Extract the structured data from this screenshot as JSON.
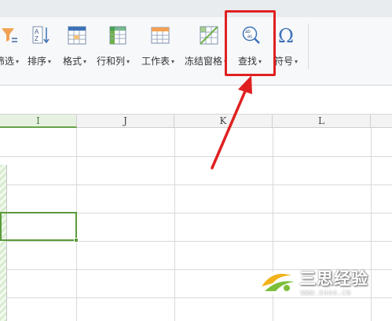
{
  "toolbar": {
    "items": [
      {
        "label": "筛选",
        "icon": "filter-icon"
      },
      {
        "label": "排序",
        "icon": "sort-icon"
      },
      {
        "label": "格式",
        "icon": "format-icon"
      },
      {
        "label": "行和列",
        "icon": "rows-columns-icon"
      },
      {
        "label": "工作表",
        "icon": "worksheet-icon"
      },
      {
        "label": "冻结窗格",
        "icon": "freeze-panes-icon"
      },
      {
        "label": "查找",
        "icon": "find-icon"
      },
      {
        "label": "符号",
        "icon": "symbol-icon"
      }
    ],
    "caret": "▾"
  },
  "columns": [
    {
      "label": "I",
      "active": true
    },
    {
      "label": "J",
      "active": false
    },
    {
      "label": "K",
      "active": false
    },
    {
      "label": "L",
      "active": false
    }
  ],
  "colors": {
    "highlight": "#e02020",
    "selection": "#5b9a3c",
    "arrow": "#e02020"
  },
  "watermark": {
    "title": "三思经验",
    "url": "WWW.X444.CN"
  }
}
